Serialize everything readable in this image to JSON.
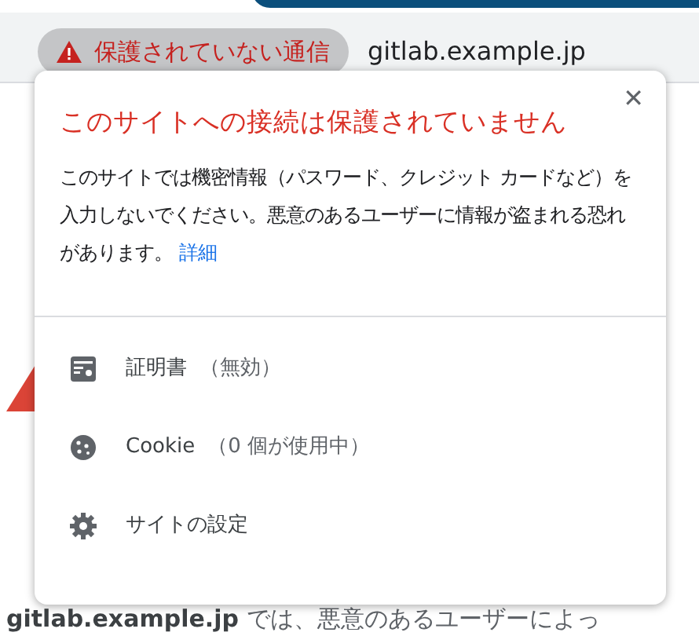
{
  "address_bar": {
    "security_chip": "保護されていない通信",
    "url": "gitlab.example.jp"
  },
  "page": {
    "sentence_host": "gitlab.example.jp",
    "sentence_rest": "では、悪意のあるユーザーによっ"
  },
  "popup": {
    "close": "✕",
    "title": "このサイトへの接続は保護されていません",
    "message": "このサイトでは機密情報（パスワード、クレジット カードなど）を入力しないでください。悪意のあるユーザーに情報が盗まれる恐れがあります。",
    "link": "詳細",
    "items": [
      {
        "kind": "certificate",
        "label": "証明書",
        "note": "（無効）"
      },
      {
        "kind": "cookie",
        "label": "Cookie",
        "note": "（0 個が使用中）"
      },
      {
        "kind": "settings",
        "label": "サイトの設定"
      }
    ]
  }
}
